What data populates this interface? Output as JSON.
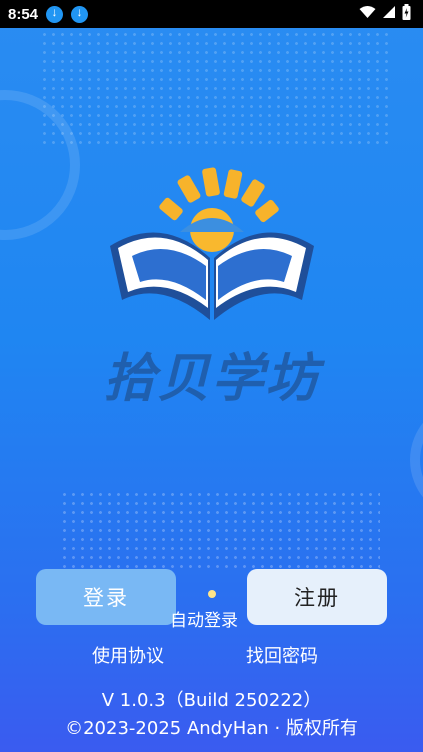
{
  "status_bar": {
    "time": "8:54"
  },
  "brand": {
    "name": "拾贝学坊"
  },
  "actions": {
    "login_label": "登录",
    "register_label": "注册",
    "auto_login_label": "自动登录",
    "terms_label": "使用协议",
    "forgot_password_label": "找回密码"
  },
  "footer": {
    "version": "V 1.0.3（Build 250222）",
    "copyright": "©2023-2025 AndyHan · 版权所有"
  },
  "colors": {
    "background_top": "#2a8cf2",
    "background_bottom": "#3a5bf0",
    "login_button": "#79b8f4",
    "register_button": "#e6f0fb",
    "brand_text": "#1f5fae"
  }
}
